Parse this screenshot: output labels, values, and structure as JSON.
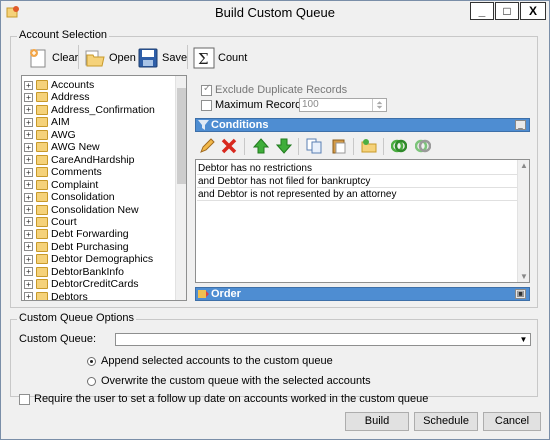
{
  "window": {
    "title": "Build Custom Queue"
  },
  "titlebar_buttons": {
    "minimize": "_",
    "maximize": "□",
    "close": "X"
  },
  "account_selection": {
    "legend": "Account Selection",
    "toolbar": {
      "clear": "Clear",
      "open": "Open",
      "save": "Save",
      "count": "Count"
    },
    "tree_items": [
      "Accounts",
      "Address",
      "Address_Confirmation",
      "AIM",
      "AWG",
      "AWG New",
      "CareAndHardship",
      "Comments",
      "Complaint",
      "Consolidation",
      "Consolidation New",
      "Court",
      "Debt Forwarding",
      "Debt Purchasing",
      "Debtor Demographics",
      "DebtorBankInfo",
      "DebtorCreditCards",
      "Debtors"
    ],
    "exclude_duplicates": {
      "label": "Exclude Duplicate Records",
      "checked": true
    },
    "maximum_records": {
      "label": "Maximum Records",
      "value": "100",
      "checked": false
    },
    "conditions": {
      "title": "Conditions",
      "items": [
        "Debtor has no restrictions",
        "and Debtor has not filed for bankruptcy",
        "and Debtor is not represented by an attorney"
      ]
    },
    "order": {
      "title": "Order"
    }
  },
  "custom_queue_options": {
    "legend": "Custom Queue Options",
    "queue_label": "Custom Queue:",
    "queue_value": "",
    "append_label": "Append selected accounts to the custom queue",
    "overwrite_label": "Overwrite the custom queue with the selected accounts",
    "selected": "append"
  },
  "require_followup": {
    "label": "Require the user to set a follow up date on accounts worked in the custom queue",
    "checked": false
  },
  "buttons": {
    "build": "Build",
    "schedule": "Schedule",
    "cancel": "Cancel"
  },
  "colors": {
    "band": "#4e8dd2",
    "window_bg": "#f0f0f0"
  }
}
